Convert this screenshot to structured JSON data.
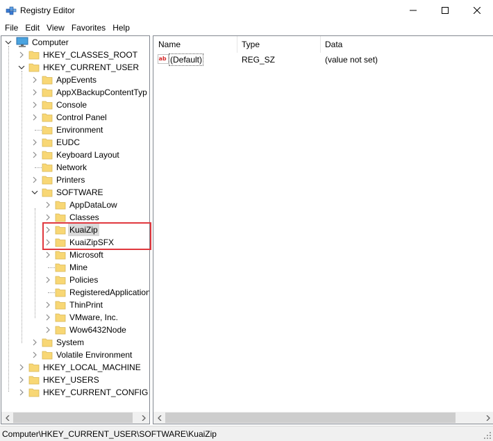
{
  "window": {
    "title": "Registry Editor"
  },
  "menu": [
    "File",
    "Edit",
    "View",
    "Favorites",
    "Help"
  ],
  "tree": {
    "root": "Computer",
    "items": [
      {
        "label": "HKEY_CLASSES_ROOT"
      },
      {
        "label": "HKEY_CURRENT_USER"
      },
      {
        "label": "AppEvents"
      },
      {
        "label": "AppXBackupContentTyp"
      },
      {
        "label": "Console"
      },
      {
        "label": "Control Panel"
      },
      {
        "label": "Environment"
      },
      {
        "label": "EUDC"
      },
      {
        "label": "Keyboard Layout"
      },
      {
        "label": "Network"
      },
      {
        "label": "Printers"
      },
      {
        "label": "SOFTWARE"
      },
      {
        "label": "AppDataLow"
      },
      {
        "label": "Classes"
      },
      {
        "label": "KuaiZip"
      },
      {
        "label": "KuaiZipSFX"
      },
      {
        "label": "Microsoft"
      },
      {
        "label": "Mine"
      },
      {
        "label": "Policies"
      },
      {
        "label": "RegisteredApplication"
      },
      {
        "label": "ThinPrint"
      },
      {
        "label": "VMware, Inc."
      },
      {
        "label": "Wow6432Node"
      },
      {
        "label": "System"
      },
      {
        "label": "Volatile Environment"
      },
      {
        "label": "HKEY_LOCAL_MACHINE"
      },
      {
        "label": "HKEY_USERS"
      },
      {
        "label": "HKEY_CURRENT_CONFIG"
      }
    ]
  },
  "list": {
    "columns": [
      "Name",
      "Type",
      "Data"
    ],
    "rows": [
      {
        "icon": "ab",
        "name": "(Default)",
        "type": "REG_SZ",
        "data": "(value not set)"
      }
    ]
  },
  "status": {
    "path": "Computer\\HKEY_CURRENT_USER\\SOFTWARE\\KuaiZip"
  },
  "colors": {
    "highlight": "#e0383e",
    "folder": "#f8d775",
    "selected": "#d9d9d9"
  }
}
